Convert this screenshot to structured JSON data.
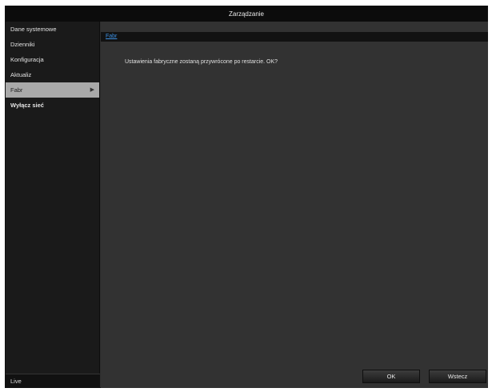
{
  "window": {
    "title": "Zarządzanie"
  },
  "sidebar": {
    "items": [
      {
        "label": "Dane systemowe"
      },
      {
        "label": "Dzienniki"
      },
      {
        "label": "Konfiguracja"
      },
      {
        "label": "Aktualiz"
      },
      {
        "label": "Fabr",
        "active": true
      },
      {
        "label": "Wyłącz sieć"
      }
    ],
    "live_label": "Live"
  },
  "main": {
    "tab_label": "Fabr",
    "message": "Ustawienia fabryczne zostaną przywrócone po restarcie. OK?"
  },
  "buttons": {
    "ok": "OK",
    "back": "Wstecz"
  },
  "colors": {
    "accent_link": "#3c8fe0",
    "active_item_bg": "#a9a9a9"
  }
}
